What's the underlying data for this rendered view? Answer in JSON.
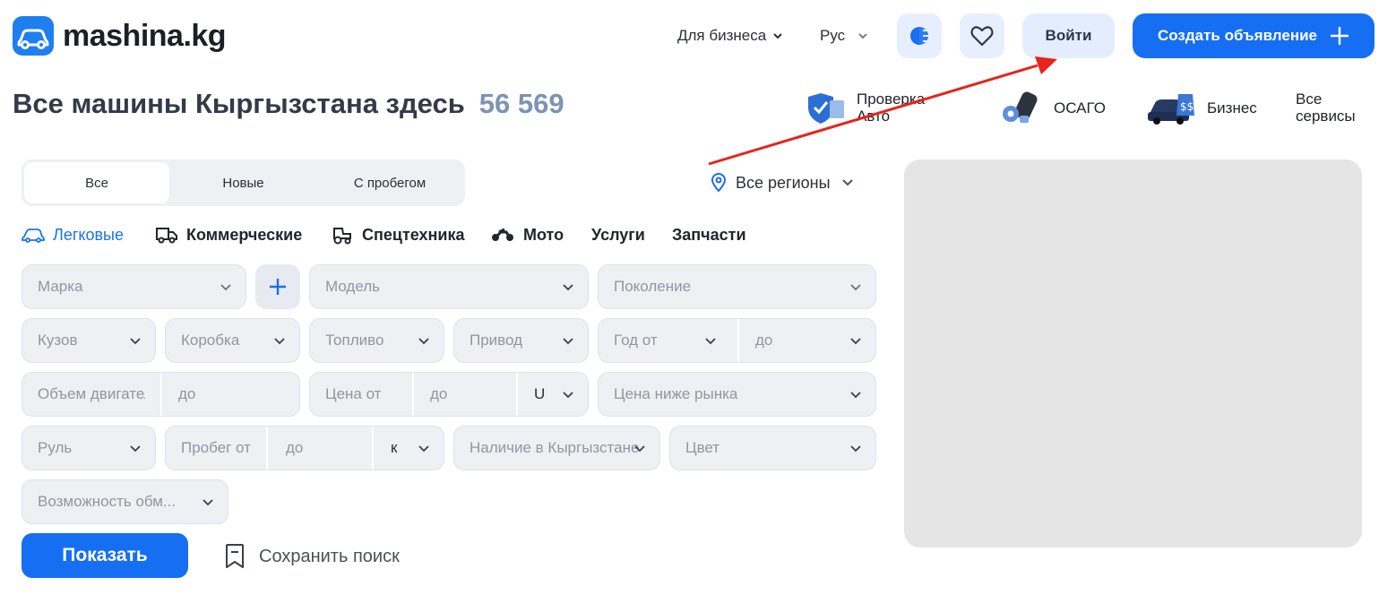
{
  "header": {
    "logo_text": "mashina.kg",
    "for_business": "Для бизнеса",
    "language": "Рус",
    "theme_icon": "theme-toggle-icon",
    "favorites_icon": "heart-icon",
    "login": "Войти",
    "create_ad": "Создать объявление"
  },
  "headline": {
    "title": "Все машины Кыргызстана здесь",
    "count": "56 569"
  },
  "services": [
    {
      "line1": "Проверка",
      "line2": "Авто"
    },
    {
      "line1": "ОСАГО",
      "line2": ""
    },
    {
      "line1": "Бизнес",
      "line2": ""
    },
    {
      "line1": "Все",
      "line2": "сервисы"
    }
  ],
  "tabs": [
    "Все",
    "Новые",
    "С пробегом"
  ],
  "region": "Все регионы",
  "categories": [
    "Легковые",
    "Коммерческие",
    "Спецтехника",
    "Мото",
    "Услуги",
    "Запчасти"
  ],
  "filters": {
    "brand": "Марка",
    "model": "Модель",
    "generation": "Поколение",
    "body": "Кузов",
    "gearbox": "Коробка",
    "fuel": "Топливо",
    "drive": "Привод",
    "year_from": "Год от",
    "year_to": "до",
    "engine_from": "Объем двигателя",
    "engine_to": "до",
    "price_from": "Цена от",
    "price_to": "до",
    "currency": "U",
    "below_market": "Цена ниже рынка",
    "wheel": "Руль",
    "mileage_from": "Пробег от",
    "mileage_to": "до",
    "mileage_unit": "к",
    "availability": "Наличие в Кыргызстане",
    "color": "Цвет",
    "exchange": "Возможность обм..."
  },
  "actions": {
    "show": "Показать",
    "save_search": "Сохранить поиск"
  },
  "colors": {
    "primary": "#166ff2",
    "accent_link": "#1a73e8",
    "count": "#7d93b3",
    "annotation_arrow": "#e8231c"
  }
}
